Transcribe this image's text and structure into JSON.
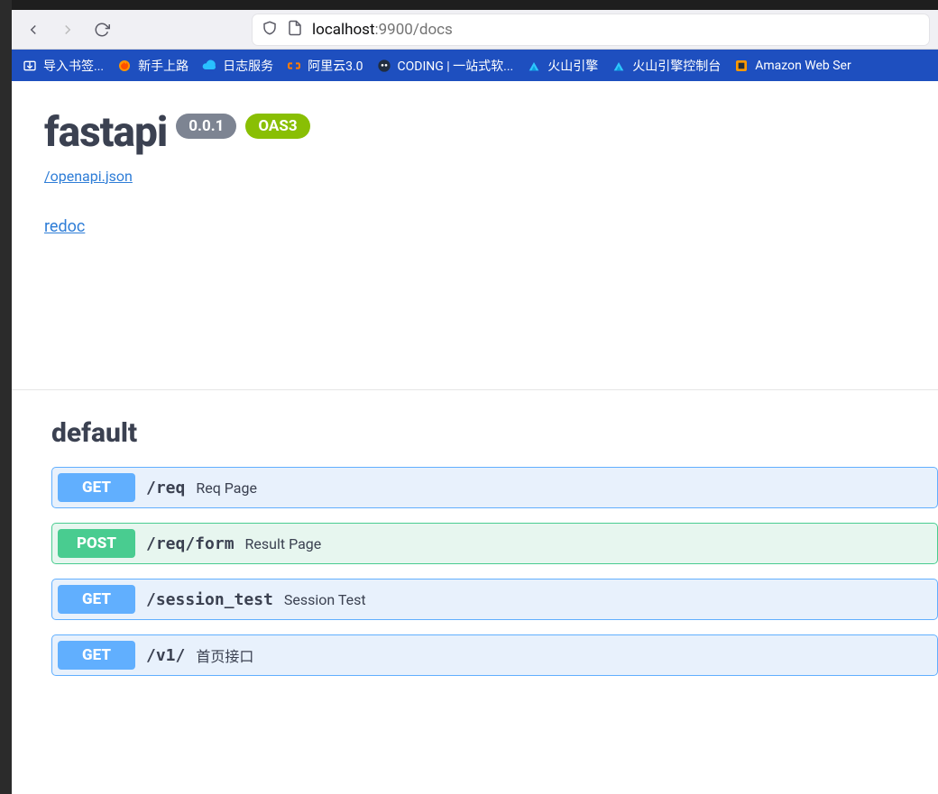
{
  "browser": {
    "url_host": "localhost",
    "url_port_path": ":9900/docs",
    "bookmarks": [
      {
        "icon": "import",
        "label": "导入书签..."
      },
      {
        "icon": "firefox",
        "label": "新手上路"
      },
      {
        "icon": "cloud",
        "label": "日志服务"
      },
      {
        "icon": "aliyun",
        "label": "阿里云3.0"
      },
      {
        "icon": "coding",
        "label": "CODING | 一站式软..."
      },
      {
        "icon": "volcano",
        "label": "火山引擎"
      },
      {
        "icon": "volcano",
        "label": "火山引擎控制台"
      },
      {
        "icon": "aws",
        "label": "Amazon Web Ser"
      }
    ]
  },
  "api": {
    "title": "fastapi",
    "version": "0.0.1",
    "oas_label": "OAS3",
    "openapi_link": "/openapi.json",
    "redoc_link": "redoc"
  },
  "section": {
    "name": "default",
    "ops": [
      {
        "method": "GET",
        "path": "/req",
        "summary": "Req Page"
      },
      {
        "method": "POST",
        "path": "/req/form",
        "summary": "Result Page"
      },
      {
        "method": "GET",
        "path": "/session_test",
        "summary": "Session Test"
      },
      {
        "method": "GET",
        "path": "/v1/",
        "summary": "首页接口"
      }
    ]
  }
}
